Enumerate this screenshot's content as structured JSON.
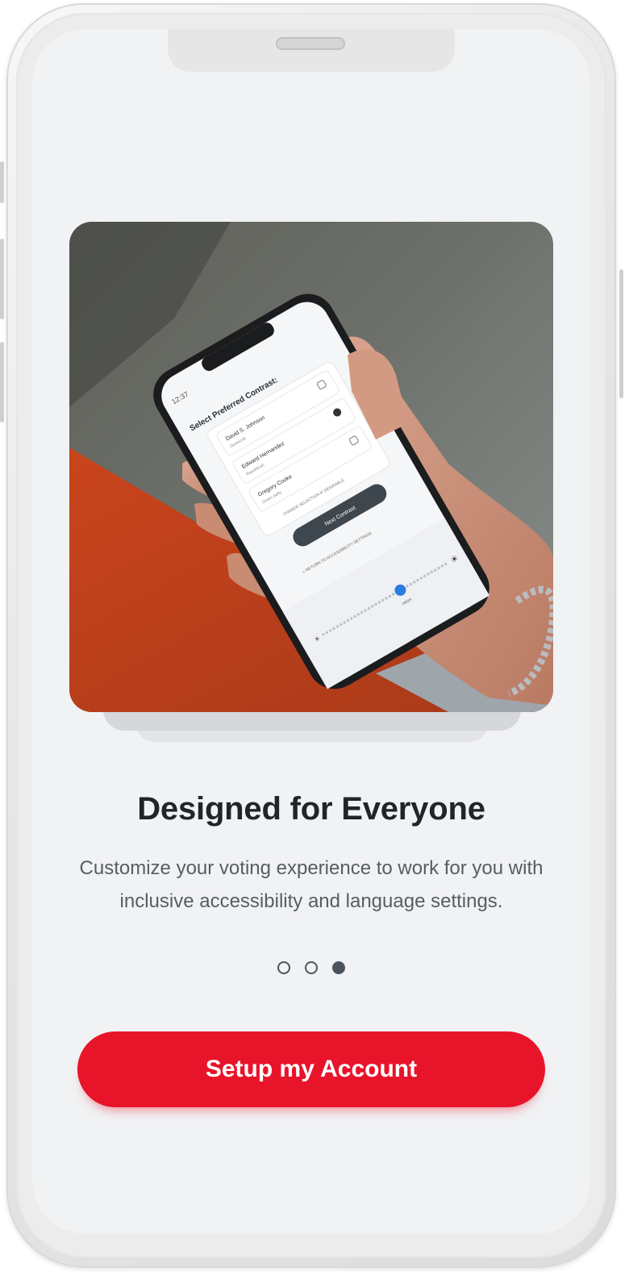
{
  "onboarding": {
    "title": "Designed for Everyone",
    "subtitle": "Customize your voting experience to work for you with inclusive accessibility and language settings.",
    "pager": {
      "total": 3,
      "active_index": 2
    },
    "cta_label": "Setup my Account"
  },
  "colors": {
    "screen_background": "#f1f2f4",
    "primary_button": "#e8142a",
    "title_text": "#1f252b",
    "body_text": "#585d63",
    "dot": "#4b545c"
  },
  "hero_image": {
    "icon": "photo-hand-holding-phone",
    "inner_app": {
      "time": "12:37",
      "heading": "Select Preferred Contrast:",
      "options": [
        {
          "name": "David S. Johnson",
          "party": "Democrat",
          "selected": false
        },
        {
          "name": "Edward Hernandez",
          "party": "Republican",
          "selected": true
        },
        {
          "name": "Gregory Cooke",
          "party": "Green party",
          "selected": false
        }
      ],
      "note": "CHANGE SELECTION IF DESIRABLE",
      "button_label": "Next Contrast",
      "back_link": "< RETURN TO ACCESSIBILITY SETTINGS",
      "slider_caption": "HIGH",
      "slider_level": 0.62
    }
  }
}
